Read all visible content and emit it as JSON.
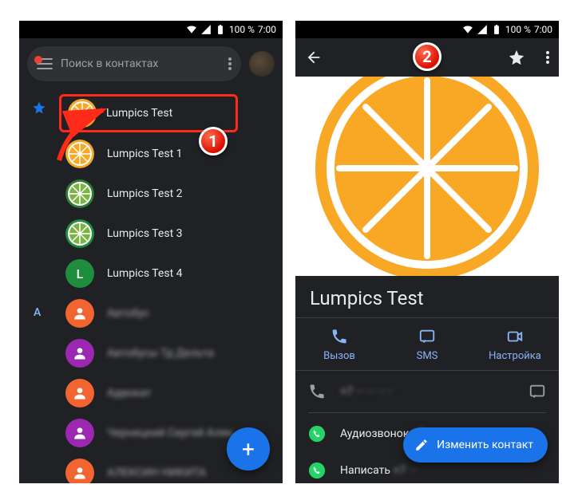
{
  "status": {
    "battery_pct": "100 %",
    "time": "7:00"
  },
  "left": {
    "search": {
      "placeholder": "Поиск в контактах"
    },
    "contacts": [
      {
        "name": "Lumpics Test",
        "avatar_type": "orange_big",
        "star": true,
        "highlighted": true
      },
      {
        "name": "Lumpics Test 1",
        "avatar_type": "orange_small",
        "star": false
      },
      {
        "name": "Lumpics Test 2",
        "avatar_type": "lime_dark",
        "star": false
      },
      {
        "name": "Lumpics Test 3",
        "avatar_type": "lime_green",
        "star": false
      },
      {
        "name": "Lumpics Test 4",
        "avatar_type": "letter",
        "letter": "L",
        "bg": "#1e8e3e"
      }
    ],
    "section_a": {
      "letter": "A",
      "rows": [
        {
          "name": "Автобус",
          "bg": "#f26430"
        },
        {
          "name": "Автобусы Тд Дельта",
          "bg": "#9c27b0"
        },
        {
          "name": "Адвокат",
          "bg": "#f26430"
        },
        {
          "name": "Чернецкий Сергей Алек...",
          "bg": "#9c27b0"
        },
        {
          "name": "АЛЕКСИН НИКИТА",
          "bg": "#f26430"
        }
      ]
    }
  },
  "right": {
    "contact_name": "Lumpics Test",
    "actions": {
      "call": "Вызов",
      "sms": "SMS",
      "video": "Настройка"
    },
    "phone": "+7 ··· ··· ·· ··",
    "whatsapp_audio": "Аудиозвонок",
    "whatsapp_write": "Написать",
    "edit_label": "Изменить контакт"
  },
  "callouts": {
    "one": "1",
    "two": "2"
  }
}
